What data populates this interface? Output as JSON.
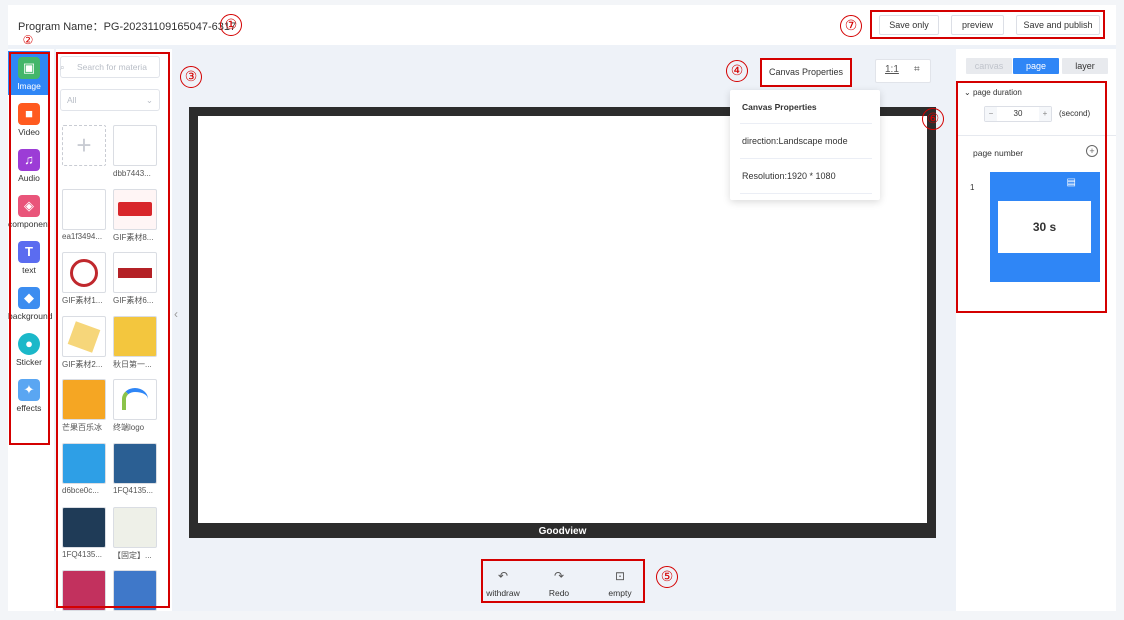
{
  "header": {
    "program_name": "Program Name：PG-20231109165047-6317",
    "buttons": {
      "save_only": "Save only",
      "preview": "preview",
      "save_publish": "Save and publish"
    }
  },
  "annotations": [
    "①",
    "②",
    "③",
    "④",
    "⑤",
    "⑥",
    "⑦"
  ],
  "tools": [
    {
      "label": "Image",
      "icon": "image-icon",
      "color": "#43b66a"
    },
    {
      "label": "Video",
      "icon": "video-icon",
      "color": "#ff5a1f"
    },
    {
      "label": "Audio",
      "icon": "music-icon",
      "color": "#9c3cd6"
    },
    {
      "label": "component",
      "icon": "cube-icon",
      "color": "#e9557a"
    },
    {
      "label": "text",
      "icon": "text-icon",
      "color": "#5b6cf0"
    },
    {
      "label": "background",
      "icon": "paint-bucket-icon",
      "color": "#3c8df0"
    },
    {
      "label": "Sticker",
      "icon": "sticker-icon",
      "color": "#1bb8c9"
    },
    {
      "label": "effects",
      "icon": "magic-wand-icon",
      "color": "#5aa6f2"
    }
  ],
  "material": {
    "search_placeholder": "Search for materia",
    "filter_value": "All",
    "items": [
      {
        "caption": ""
      },
      {
        "caption": "dbb7443..."
      },
      {
        "caption": "ea1f3494..."
      },
      {
        "caption": "GIF素材8..."
      },
      {
        "caption": "GIF素材1..."
      },
      {
        "caption": "GIF素材6..."
      },
      {
        "caption": "GIF素材2..."
      },
      {
        "caption": "秋日第一..."
      },
      {
        "caption": "芒果百乐冰"
      },
      {
        "caption": "终端logo"
      },
      {
        "caption": "d6bce0c..."
      },
      {
        "caption": "1FQ4135..."
      },
      {
        "caption": "1FQ4135..."
      },
      {
        "caption": "【固定】..."
      },
      {
        "caption": ""
      },
      {
        "caption": ""
      }
    ]
  },
  "canvas": {
    "properties_button": "Canvas Properties",
    "ratio_label": "1:1",
    "brand_label": "Goodview",
    "popover": {
      "title": "Canvas Properties",
      "direction": "direction:Landscape mode",
      "resolution": "Resolution:1920 * 1080"
    }
  },
  "history": {
    "withdraw": "withdraw",
    "redo": "Redo",
    "empty": "empty"
  },
  "right_panel": {
    "tabs": {
      "canvas": "canvas",
      "page": "page",
      "layer": "layer"
    },
    "page_duration_label": "page duration",
    "duration_value": "30",
    "duration_unit": "(second)",
    "stepper_minus": "−",
    "stepper_plus": "+",
    "page_number_label": "page number",
    "page_index": "1",
    "page_duration_display": "30 s"
  },
  "colors": {
    "accent": "#2f86f6",
    "annotation": "#d40000"
  }
}
